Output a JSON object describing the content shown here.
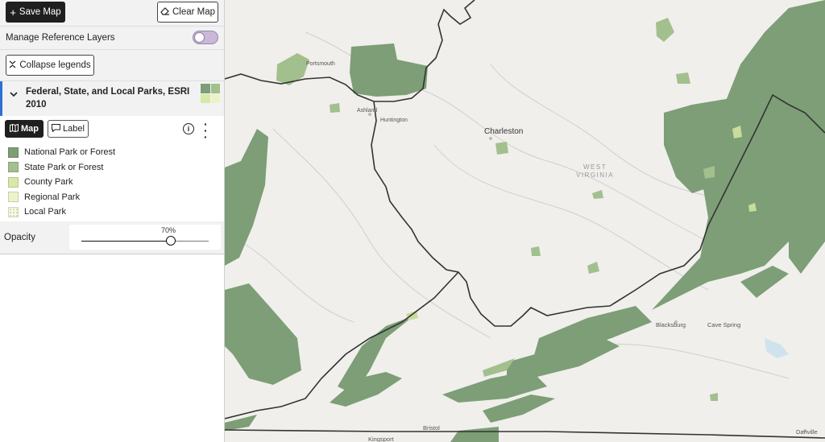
{
  "toolbar": {
    "save_label": "Save Map",
    "clear_label": "Clear Map"
  },
  "reference_layers": {
    "label": "Manage Reference Layers",
    "enabled": false
  },
  "collapse_legends_label": "Collapse legends",
  "layer": {
    "title": "Federal, State, and Local Parks, ESRI 2010",
    "tabs": {
      "map_label": "Map",
      "label_label": "Label"
    },
    "legend": [
      {
        "label": "National Park or Forest",
        "color": "#7d9e76"
      },
      {
        "label": "State Park or Forest",
        "color": "#a2c08e"
      },
      {
        "label": "County Park",
        "color": "#d7e8a8"
      },
      {
        "label": "Regional Park",
        "color": "#eef2c8"
      },
      {
        "label": "Local Park",
        "color": "#f7f8e4"
      }
    ],
    "opacity": {
      "label": "Opacity",
      "value_label": "70%",
      "value": 0.7
    }
  },
  "map": {
    "labels": {
      "portsmouth": "Portsmouth",
      "ashland": "Ashland",
      "huntington": "Huntington",
      "charleston": "Charleston",
      "state": "WEST\nVIRGINIA",
      "blacksburg": "Blacksburg",
      "cave_spring": "Cave Spring",
      "bristol": "Bristol",
      "kingsport": "Kingsport",
      "danville": "Danville"
    },
    "colors": {
      "background": "#eceae6",
      "forest": "#7d9e76",
      "state_park": "#a2c08e",
      "county_park": "#c8dc9c",
      "border": "#333333",
      "river": "#c7c7c7"
    }
  }
}
